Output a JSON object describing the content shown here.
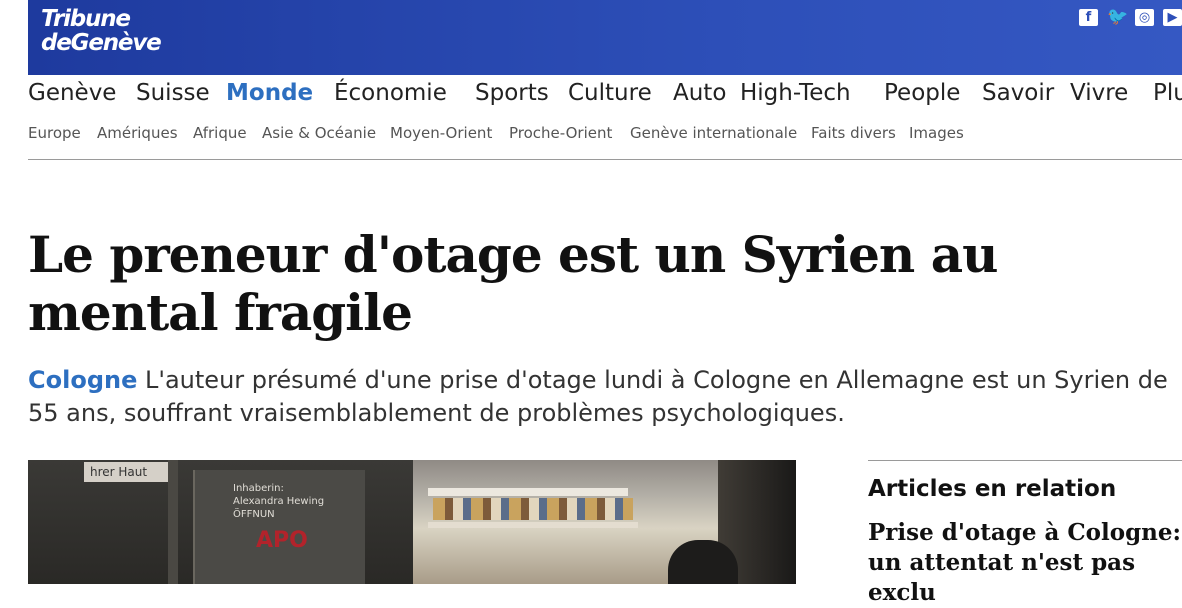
{
  "header": {
    "logo_line1": "Tribune",
    "logo_line2": "deGenève",
    "social": [
      {
        "icon": "facebook-icon",
        "glyph": "f"
      },
      {
        "icon": "twitter-icon",
        "glyph": "🐦"
      },
      {
        "icon": "instagram-icon",
        "glyph": "◎"
      },
      {
        "icon": "youtube-icon",
        "glyph": "▶"
      }
    ]
  },
  "main_nav": [
    "Genève",
    "Suisse",
    "Monde",
    "Économie",
    "Sports",
    "Culture",
    "Auto",
    "High-Tech",
    "People",
    "Savoir",
    "Vivre",
    "Plus"
  ],
  "main_nav_active": "Monde",
  "sub_nav": [
    "Europe",
    "Amériques",
    "Afrique",
    "Asie & Océanie",
    "Moyen-Orient",
    "Proche-Orient",
    "Genève internationale",
    "Faits divers",
    "Images"
  ],
  "article": {
    "headline": "Le preneur d'otage est un Syrien au mental fragile",
    "place": "Cologne",
    "lead": "L'auteur présumé d'une prise d'otage lundi à Cologne en Allemagne est un Syrien de 55 ans, souffrant vraisemblablement de problèmes psychologiques.",
    "photo": {
      "sign_text": "hrer Haut",
      "glass_line1": "Inhaberin:",
      "glass_line2": "Alexandra Hewing",
      "glass_line3": "ÖFFNUN",
      "red_text": "APO"
    }
  },
  "related": {
    "title": "Articles en relation",
    "items": [
      "Prise d'otage à Cologne: un attentat n'est pas exclu"
    ]
  },
  "colors": {
    "brand": "#2d4fb8",
    "accent": "#2d6fc0"
  }
}
